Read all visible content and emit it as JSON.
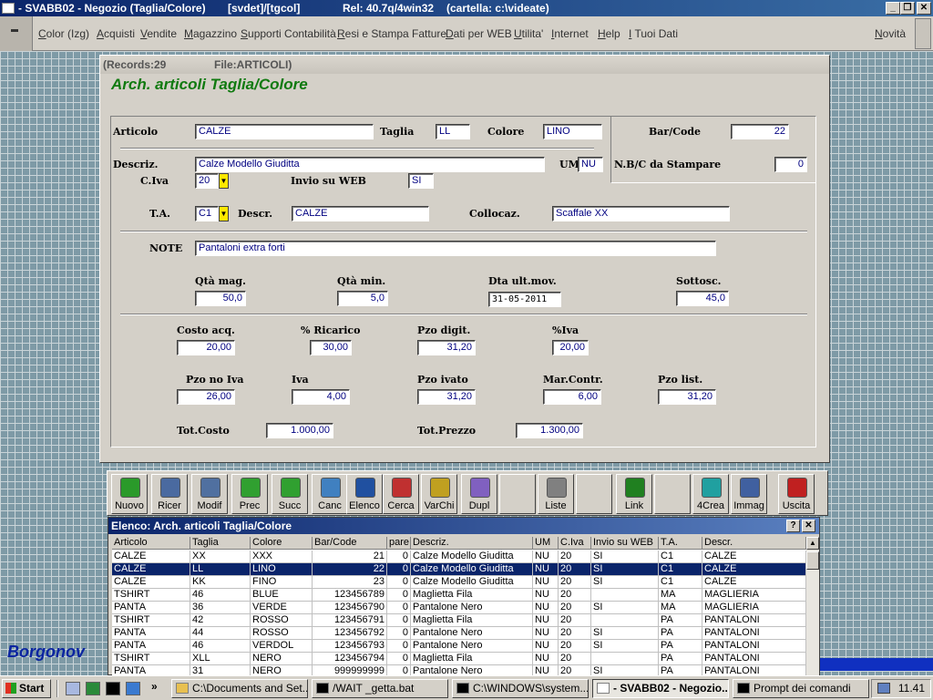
{
  "window": {
    "title": "- SVABB02 - Negozio (Taglia/Colore)",
    "context": "[svdet]/[tgcol]",
    "release": "Rel: 40.7q/4win32",
    "folder": "(cartella: c:\\videate)"
  },
  "menu": [
    "Color (Izg)",
    "Acquisti",
    "Vendite",
    "Magazzino",
    "Supporti Contabilità",
    "Resi e Stampa Fatture",
    "Dati per WEB",
    "Utilita'",
    "Internet",
    "Help",
    "I Tuoi Dati"
  ],
  "menu_right": "Novità",
  "form": {
    "records": "(Records:29",
    "file": "File:ARTICOLI)",
    "title": "Arch. articoli Taglia/Colore",
    "labels": {
      "articolo": "Articolo",
      "taglia": "Taglia",
      "colore": "Colore",
      "barcode": "Bar/Code",
      "descriz": "Descriz.",
      "um": "UM",
      "nbc": "N.B/C da Stampare",
      "civa": "C.Iva",
      "invio": "Invio su WEB",
      "ta": "T.A.",
      "descr": "Descr.",
      "collocaz": "Collocaz.",
      "note": "NOTE",
      "qtamag": "Qtà mag.",
      "qtamin": "Qtà min.",
      "dtault": "Dta ult.mov.",
      "sottosc": "Sottosc.",
      "costoacq": "Costo acq.",
      "ricarico": "% Ricarico",
      "pzodigit": "Pzo digit.",
      "piva": "%Iva",
      "pzonoiva": "Pzo no Iva",
      "iva": "Iva",
      "pzoivato": "Pzo ivato",
      "marcontr": "Mar.Contr.",
      "pzolist": "Pzo list.",
      "totcosto": "Tot.Costo",
      "totprezzo": "Tot.Prezzo"
    },
    "values": {
      "articolo": "CALZE",
      "taglia": "LL",
      "colore": "LINO",
      "barcode": "22",
      "descriz": "Calze Modello Giuditta",
      "um": "NU",
      "nbc": "0",
      "civa": "20",
      "invio": "SI",
      "ta": "C1",
      "descr": "CALZE",
      "collocaz": "Scaffale XX",
      "note": "Pantaloni extra forti",
      "qtamag": "50,0",
      "qtamin": "5,0",
      "dtault": "31-05-2011",
      "sottosc": "45,0",
      "costoacq": "20,00",
      "ricarico": "30,00",
      "pzodigit": "31,20",
      "piva": "20,00",
      "pzonoiva": "26,00",
      "iva": "4,00",
      "pzoivato": "31,20",
      "marcontr": "6,00",
      "pzolist": "31,20",
      "totcosto": "1.000,00",
      "totprezzo": "1.300,00"
    }
  },
  "toolbar": [
    {
      "label": "Nuovo",
      "icon": "new-document-icon",
      "color": "#2a9a2a"
    },
    {
      "label": "Ricer",
      "icon": "magnifier-icon",
      "color": "#4a6aa0"
    },
    {
      "label": "Modif",
      "icon": "edit-document-icon",
      "color": "#5070a0"
    },
    {
      "label": "Prec",
      "icon": "arrow-left-icon",
      "color": "#30a030"
    },
    {
      "label": "Succ",
      "icon": "arrow-right-icon",
      "color": "#30a030"
    },
    {
      "label": "Canc",
      "icon": "trash-icon",
      "color": "#4080c0"
    },
    {
      "label": "Elenco",
      "icon": "list-icon",
      "color": "#2050a0"
    },
    {
      "label": "Cerca",
      "icon": "brush-icon",
      "color": "#c03030"
    },
    {
      "label": "VarChi",
      "icon": "keys-icon",
      "color": "#c0a020"
    },
    {
      "label": "Dupl",
      "icon": "duplicate-icon",
      "color": "#8060c0"
    },
    {
      "label": "",
      "icon": "",
      "color": ""
    },
    {
      "label": "Liste",
      "icon": "printer-icon",
      "color": "#808080"
    },
    {
      "label": "",
      "icon": "",
      "color": ""
    },
    {
      "label": "Link",
      "icon": "network-icon",
      "color": "#208020"
    },
    {
      "label": "",
      "icon": "",
      "color": ""
    },
    {
      "label": "4Crea",
      "icon": "picture-create-icon",
      "color": "#20a0a0"
    },
    {
      "label": "Immag",
      "icon": "id-card-icon",
      "color": "#4060a0"
    },
    {
      "label": "Uscita",
      "icon": "exit-door-icon",
      "color": "#c02020"
    }
  ],
  "list": {
    "title": "Elenco: Arch. articoli Taglia/Colore",
    "columns": [
      "Articolo",
      "Taglia",
      "Colore",
      "Bar/Code",
      "pare",
      "Descriz.",
      "UM",
      "C.Iva",
      "Invio su WEB",
      "T.A.",
      "Descr."
    ],
    "rows": [
      [
        "CALZE",
        "XX",
        "XXX",
        "21",
        "0",
        "Calze Modello Giuditta",
        "NU",
        "20",
        "SI",
        "C1",
        "CALZE"
      ],
      [
        "CALZE",
        "LL",
        "LINO",
        "22",
        "0",
        "Calze Modello Giuditta",
        "NU",
        "20",
        "SI",
        "C1",
        "CALZE"
      ],
      [
        "CALZE",
        "KK",
        "FINO",
        "23",
        "0",
        "Calze Modello Giuditta",
        "NU",
        "20",
        "SI",
        "C1",
        "CALZE"
      ],
      [
        "TSHIRT",
        "46",
        "BLUE",
        "123456789",
        "0",
        "Maglietta Fila",
        "NU",
        "20",
        "",
        "MA",
        "MAGLIERIA"
      ],
      [
        "PANTA",
        "36",
        "VERDE",
        "123456790",
        "0",
        "Pantalone Nero",
        "NU",
        "20",
        "SI",
        "MA",
        "MAGLIERIA"
      ],
      [
        "TSHIRT",
        "42",
        "ROSSO",
        "123456791",
        "0",
        "Maglietta Fila",
        "NU",
        "20",
        "",
        "PA",
        "PANTALONI"
      ],
      [
        "PANTA",
        "44",
        "ROSSO",
        "123456792",
        "0",
        "Pantalone Nero",
        "NU",
        "20",
        "SI",
        "PA",
        "PANTALONI"
      ],
      [
        "PANTA",
        "46",
        "VERDOL",
        "123456793",
        "0",
        "Pantalone Nero",
        "NU",
        "20",
        "SI",
        "PA",
        "PANTALONI"
      ],
      [
        "TSHIRT",
        "XLL",
        "NERO",
        "123456794",
        "0",
        "Maglietta Fila",
        "NU",
        "20",
        "",
        "PA",
        "PANTALONI"
      ],
      [
        "PANTA",
        "31",
        "NERO",
        "999999999",
        "0",
        "Pantalone Nero",
        "NU",
        "20",
        "SI",
        "PA",
        "PANTALONI"
      ]
    ],
    "selected_row": 1
  },
  "brand": "Borgonov",
  "taskbar": {
    "start": "Start",
    "tasks": [
      "C:\\Documents and Set...",
      "/WAIT _getta.bat",
      "C:\\WINDOWS\\system...",
      "- SVABB02 - Negozio...",
      "Prompt dei comandi"
    ],
    "active_task": 3,
    "clock": "11.41"
  }
}
